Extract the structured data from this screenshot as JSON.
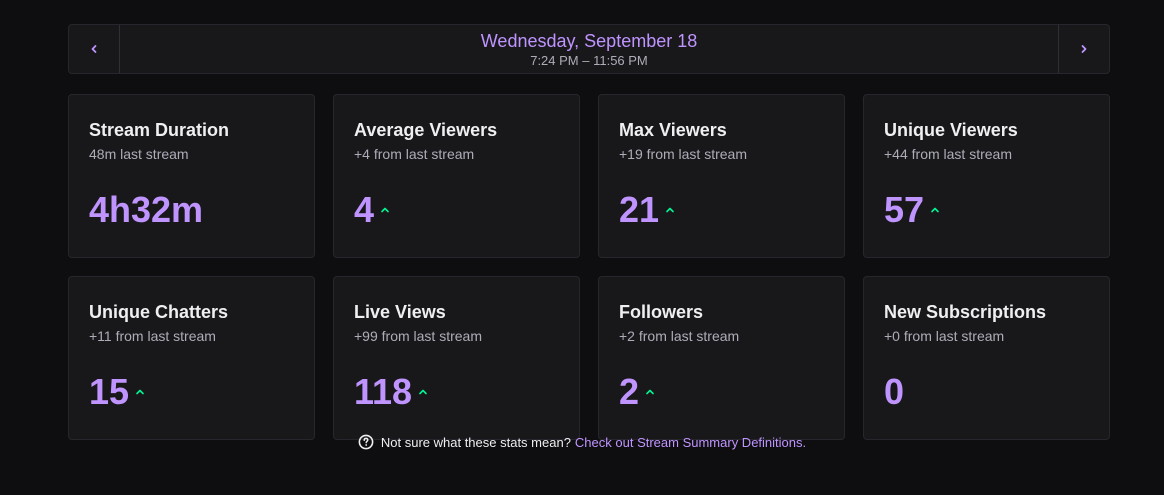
{
  "date_nav": {
    "title": "Wednesday, September 18",
    "range": "7:24 PM – 11:56 PM"
  },
  "colors": {
    "accent": "#bf94ff",
    "up": "#00f593",
    "background": "#0e0e10",
    "card": "#18181b"
  },
  "cards": [
    {
      "title": "Stream Duration",
      "sub": "48m last stream",
      "value": "4h32m",
      "trend": "none"
    },
    {
      "title": "Average Viewers",
      "sub": "+4 from last stream",
      "value": "4",
      "trend": "up"
    },
    {
      "title": "Max Viewers",
      "sub": "+19 from last stream",
      "value": "21",
      "trend": "up"
    },
    {
      "title": "Unique Viewers",
      "sub": "+44 from last stream",
      "value": "57",
      "trend": "up"
    },
    {
      "title": "Unique Chatters",
      "sub": "+11 from last stream",
      "value": "15",
      "trend": "up"
    },
    {
      "title": "Live Views",
      "sub": "+99 from last stream",
      "value": "118",
      "trend": "up"
    },
    {
      "title": "Followers",
      "sub": "+2 from last stream",
      "value": "2",
      "trend": "up"
    },
    {
      "title": "New Subscriptions",
      "sub": "+0 from last stream",
      "value": "0",
      "trend": "none"
    }
  ],
  "footer": {
    "icon": "help-circle-icon",
    "text": "Not sure what these stats mean?",
    "link": "Check out Stream Summary Definitions."
  }
}
